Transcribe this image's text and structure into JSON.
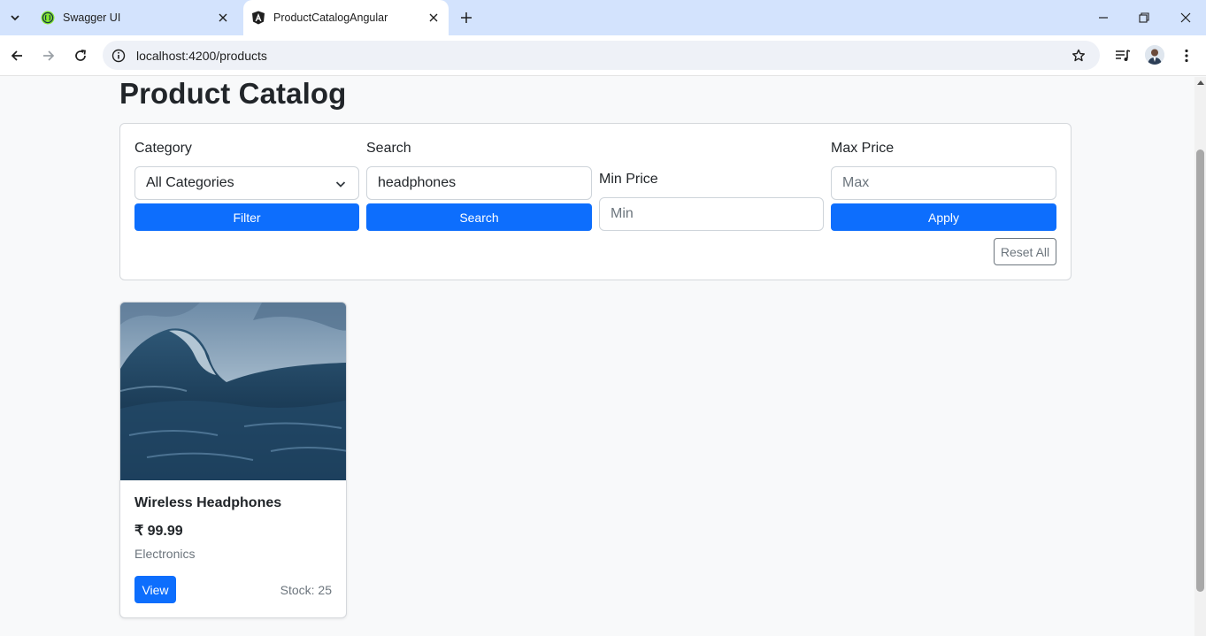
{
  "browser": {
    "tabs": [
      {
        "title": "Swagger UI",
        "favicon": "swagger-icon",
        "active": false
      },
      {
        "title": "ProductCatalogAngular",
        "favicon": "angular-icon",
        "active": true
      }
    ],
    "url": "localhost:4200/products"
  },
  "page": {
    "title": "Product Catalog"
  },
  "filters": {
    "category": {
      "label": "Category",
      "value": "All Categories",
      "button": "Filter"
    },
    "search": {
      "label": "Search",
      "value": "headphones",
      "button": "Search"
    },
    "min_price": {
      "label": "Min Price",
      "placeholder": "Min"
    },
    "max_price": {
      "label": "Max Price",
      "placeholder": "Max",
      "button": "Apply"
    },
    "reset_label": "Reset All"
  },
  "products": [
    {
      "name": "Wireless Headphones",
      "price": "₹ 99.99",
      "category": "Electronics",
      "view_label": "View",
      "stock": "Stock: 25",
      "image": "ocean-wave-image"
    }
  ],
  "colors": {
    "primary": "#0d6efd",
    "secondary": "#6c757d",
    "tabstrip": "#d3e3fd",
    "page_bg": "#f8f9fa"
  }
}
